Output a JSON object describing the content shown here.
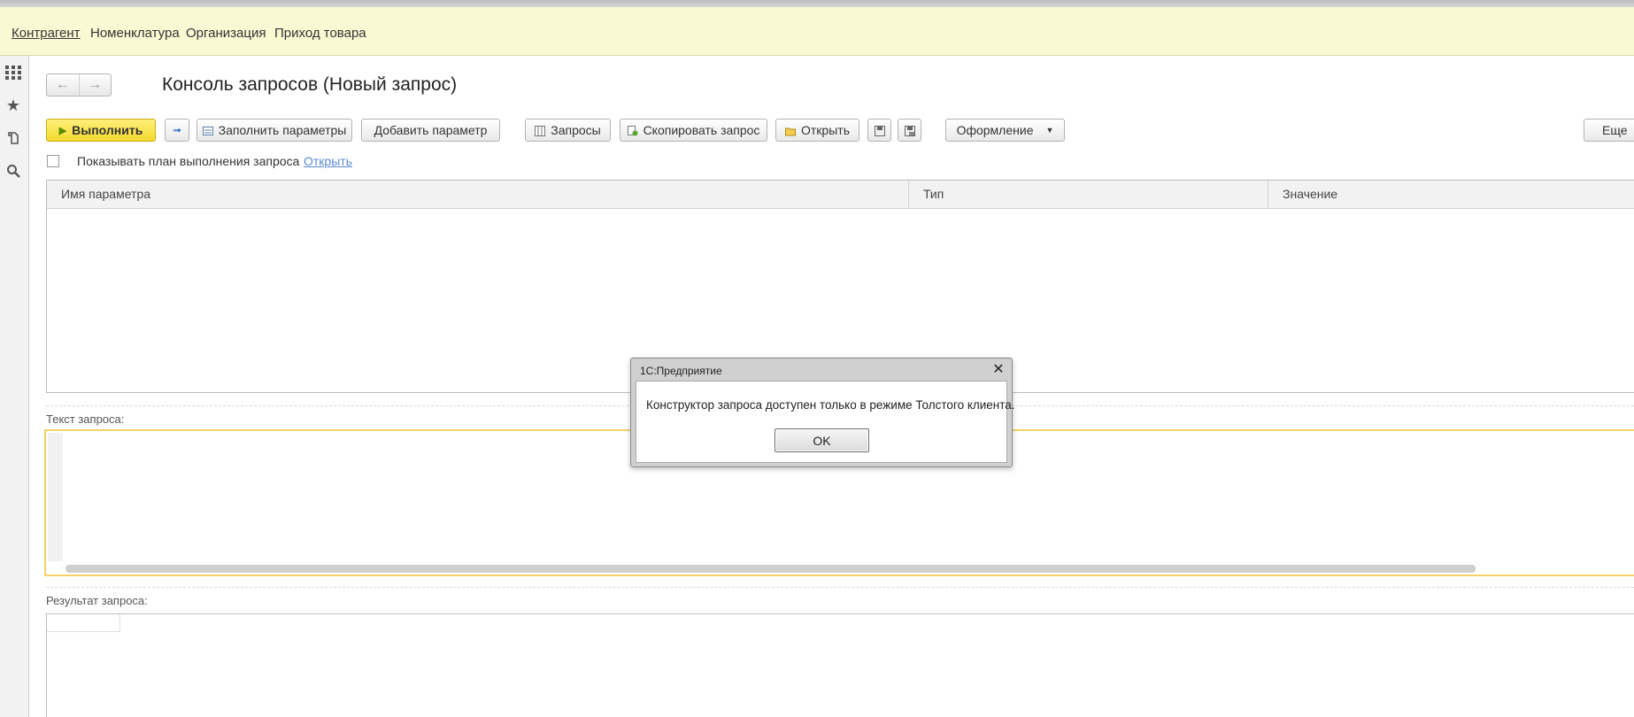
{
  "sections": {
    "items": [
      "Контрагент",
      "Номенклатура",
      "Организация",
      "Приход товара"
    ]
  },
  "sidebar": {
    "icons": [
      "apps-grid-icon",
      "favorites-star-icon",
      "history-icon",
      "search-icon"
    ]
  },
  "form": {
    "title": "Консоль запросов (Новый запрос)"
  },
  "toolbar": {
    "run_label": "Выполнить",
    "fill_params_label": "Заполнить параметры",
    "add_param_label": "Добавить параметр",
    "queries_label": "Запросы",
    "copy_query_label": "Скопировать запрос",
    "open_label": "Открыть",
    "design_label": "Оформление",
    "more_label": "Еще"
  },
  "options": {
    "show_plan_label": "Показывать план выполнения запроса",
    "open_link": "Открыть"
  },
  "params_table": {
    "columns": [
      "Имя параметра",
      "Тип",
      "Значение"
    ]
  },
  "query_text": {
    "label": "Текст запроса:"
  },
  "query_result": {
    "label": "Результат запроса:"
  },
  "dialog": {
    "title": "1С:Предприятие",
    "message": "Конструктор запроса доступен только в режиме Толстого клиента.",
    "ok_label": "OK"
  },
  "colors": {
    "sections_bg": "#fbf9d3",
    "primary_button": "#f4d92f",
    "editor_focus_border": "#f3d26b",
    "link": "#5b8bd1"
  }
}
